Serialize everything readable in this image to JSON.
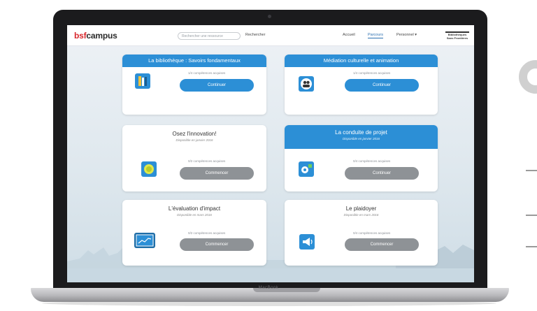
{
  "app": {
    "logo_bsf": "bsf",
    "logo_campus": "campus",
    "search_placeholder": "Rechercher une ressource",
    "search_button": "Rechercher",
    "nav": [
      "Accueil",
      "Parcours",
      "Personnel ▾"
    ],
    "partner_logo": "Bibliothèques Sans Frontières"
  },
  "device_label": "MacBook",
  "cards": [
    {
      "title": "La bibliothèque : Savoirs fondamentaux",
      "subtitle": "",
      "meta": "1/4 compétences acquises",
      "button": "Continuer",
      "icon": "books-icon"
    },
    {
      "title": "Médiation culturelle et animation",
      "subtitle": "",
      "meta": "1/4 compétences acquises",
      "button": "Continuer",
      "icon": "people-icon"
    },
    {
      "title": "Osez l'innovation!",
      "subtitle": "Disponible en janvier 2016",
      "meta": "0/2 compétences acquises",
      "button": "Commencer",
      "icon": "lightbulb-icon"
    },
    {
      "title": "La conduite de projet",
      "subtitle": "Disponible en janvier 2016",
      "meta": "0/4 compétences acquises",
      "button": "Continuer",
      "icon": "project-icon"
    },
    {
      "title": "L'évaluation d'impact",
      "subtitle": "Disponible en mars 2016",
      "meta": "0/2 compétences acquises",
      "button": "Commencer",
      "icon": "chart-icon"
    },
    {
      "title": "Le plaidoyer",
      "subtitle": "Disponible en mars 2016",
      "meta": "0/4 compétences acquises",
      "button": "Commencer",
      "icon": "megaphone-icon"
    }
  ],
  "colors": {
    "accent": "#2c8fd6",
    "brand_red": "#d8262b",
    "button_gray": "#8e9296"
  }
}
